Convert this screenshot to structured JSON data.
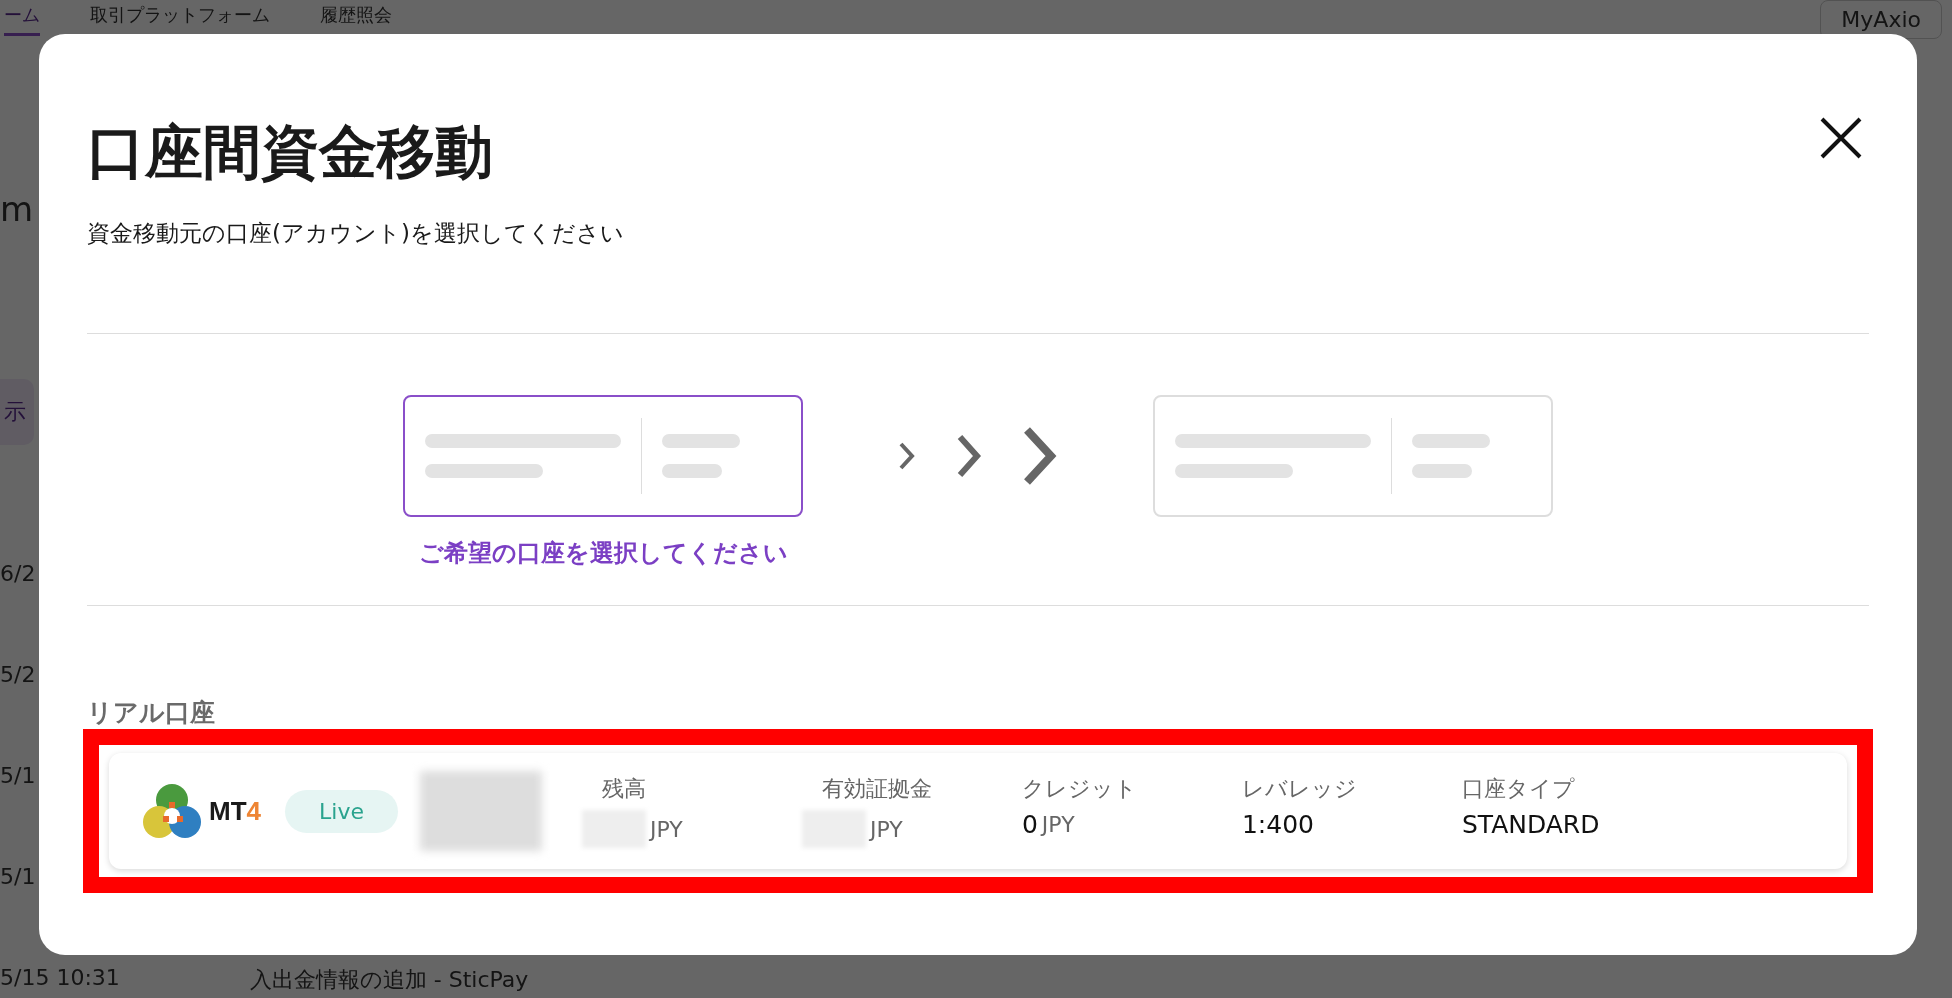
{
  "background_page": {
    "nav_tabs": [
      {
        "label": "ーム",
        "selected": true
      },
      {
        "label": "取引プラットフォーム",
        "selected": false
      },
      {
        "label": "履歴照会",
        "selected": false
      }
    ],
    "account_button": "MyAxio",
    "page_heading": "m",
    "filter_tab": "示",
    "history_rows": [
      {
        "date": "6/2"
      },
      {
        "date": "5/2"
      },
      {
        "date": "5/1"
      },
      {
        "date": "5/1"
      },
      {
        "date": "5/15 10:31",
        "description": "入出金情報の追加 - SticPay"
      }
    ]
  },
  "dialog": {
    "title": "口座間資金移動",
    "subtitle": "資金移動元の口座(アカウント)を選択してください",
    "transfer_steps": {
      "source_selected": true,
      "destination_selected": false,
      "prompt": "ご希望の口座を選択してください"
    },
    "section_label": "リアル口座",
    "accounts": [
      {
        "highlighted": true,
        "platform_name": "MT",
        "platform_version": "4",
        "status": "Live",
        "name_redacted": true,
        "fields": [
          {
            "label": "残高",
            "redacted": true,
            "currency": "JPY"
          },
          {
            "label": "有効証拠金",
            "redacted": true,
            "currency": "JPY"
          },
          {
            "label": "クレジット",
            "redacted": false,
            "value": "0",
            "currency": "JPY"
          },
          {
            "label": "レバレッジ",
            "redacted": false,
            "value": "1:400"
          },
          {
            "label": "口座タイプ",
            "redacted": false,
            "value": "STANDARD"
          }
        ]
      }
    ]
  }
}
